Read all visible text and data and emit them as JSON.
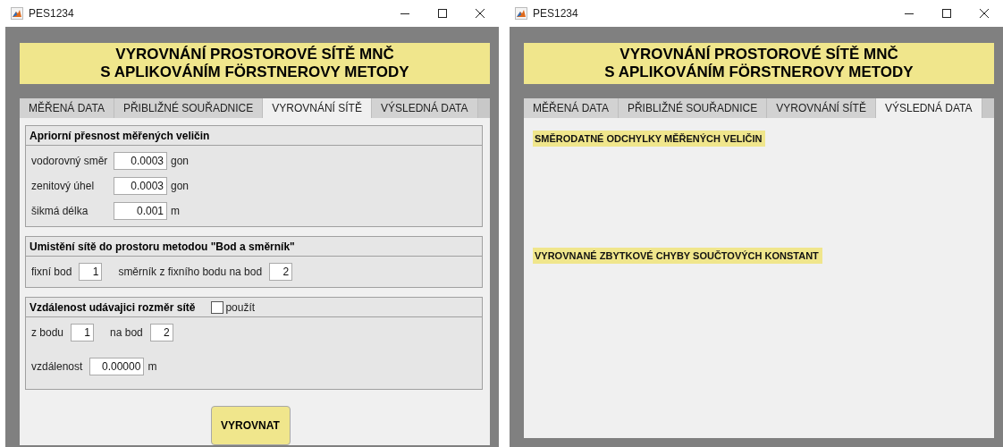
{
  "windows": [
    {
      "title": "PES1234",
      "banner": [
        "VYROVNÁNÍ PROSTOROVÉ SÍTĚ MNČ",
        "S APLIKOVÁNÍM FÖRSTNEROVY METODY"
      ],
      "tabs": [
        {
          "label": "MĚŘENÁ DATA",
          "selected": false
        },
        {
          "label": "PŘIBLIŽNÉ SOUŘADNICE",
          "selected": false
        },
        {
          "label": "VYROVNÁNÍ SÍTĚ",
          "selected": true
        },
        {
          "label": "VÝSLEDNÁ DATA",
          "selected": false
        }
      ],
      "view": {
        "kind": "adjust",
        "groups": [
          {
            "title": "Apriorní přesnost měřených veličin",
            "rows": [
              [
                {
                  "label": "vodorovný směr",
                  "value": "0.0003",
                  "unit": "gon"
                }
              ],
              [
                {
                  "label": "zenitový úhel",
                  "value": "0.0003",
                  "unit": "gon"
                }
              ],
              [
                {
                  "label": "šikmá délka",
                  "value": "0.001",
                  "unit": "m"
                }
              ]
            ]
          },
          {
            "title": "Umistění sítě do prostoru metodou \"Bod a směrník\"",
            "rows": [
              [
                {
                  "label": "fixní bod",
                  "value": "1"
                },
                {
                  "label": "směrník z fixního bodu na bod",
                  "value": "2"
                }
              ]
            ]
          },
          {
            "title": "Vzdálenost udávajici rozměr sítě",
            "checkbox": {
              "label": "použít",
              "checked": false
            },
            "rows": [
              [
                {
                  "label": "z bodu",
                  "value": "1"
                },
                {
                  "label": "na bod",
                  "value": "2"
                }
              ],
              [
                {
                  "label": "vzdálenost",
                  "value": "0.00000",
                  "unit": "m"
                }
              ]
            ]
          }
        ],
        "button": "VYROVNAT"
      }
    },
    {
      "title": "PES1234",
      "banner": [
        "VYROVNÁNÍ PROSTOROVÉ SÍTĚ MNČ",
        "S APLIKOVÁNÍM FÖRSTNEROVY METODY"
      ],
      "tabs": [
        {
          "label": "MĚŘENÁ DATA",
          "selected": false
        },
        {
          "label": "PŘIBLIŽNÉ SOUŘADNICE",
          "selected": false
        },
        {
          "label": "VYROVNÁNÍ SÍTĚ",
          "selected": false
        },
        {
          "label": "VÝSLEDNÁ DATA",
          "selected": true
        }
      ],
      "view": {
        "kind": "results",
        "sections": [
          "SMĚRODATNÉ ODCHYLKY MĚŘENÝCH VELIČIN",
          "VYROVNANÉ ZBYTKOVÉ CHYBY SOUČTOVÝCH KONSTANT"
        ]
      }
    }
  ]
}
